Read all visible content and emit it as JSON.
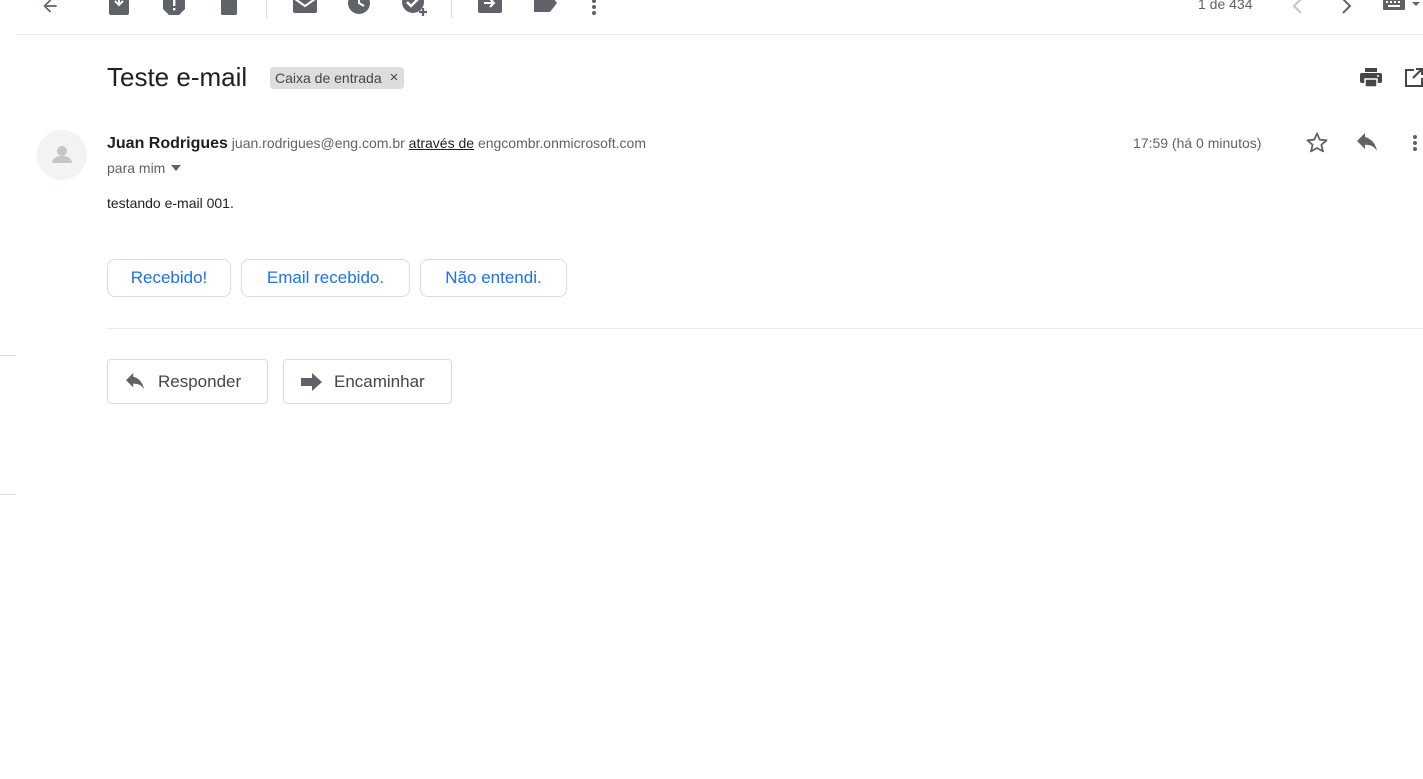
{
  "toolbar": {
    "icons": [
      "back-arrow-icon",
      "archive-icon",
      "report-spam-icon",
      "delete-icon",
      "mark-unread-icon",
      "snooze-icon",
      "add-task-icon",
      "move-to-icon",
      "label-icon",
      "more-vert-icon"
    ],
    "page_count": "1 de 434"
  },
  "email": {
    "subject": "Teste e-mail",
    "label_chip": "Caixa de entrada",
    "label_chip_remove": "×",
    "sender_name": "Juan Rodrigues",
    "sender_email": "juan.rodrigues@eng.com.br",
    "via_text": "através de",
    "via_domain": "engcombr.onmicrosoft.com",
    "to_text": "para mim",
    "timestamp": "17:59 (há 0 minutos)",
    "body": "testando e-mail 001."
  },
  "smart_replies": [
    "Recebido!",
    "Email recebido.",
    "Não entendi."
  ],
  "actions": {
    "reply_label": "Responder",
    "forward_label": "Encaminhar"
  },
  "colors": {
    "accent": "#1a73e8",
    "icon": "#5f6368",
    "chip_bg": "#dddddd",
    "border": "#dadce0"
  }
}
